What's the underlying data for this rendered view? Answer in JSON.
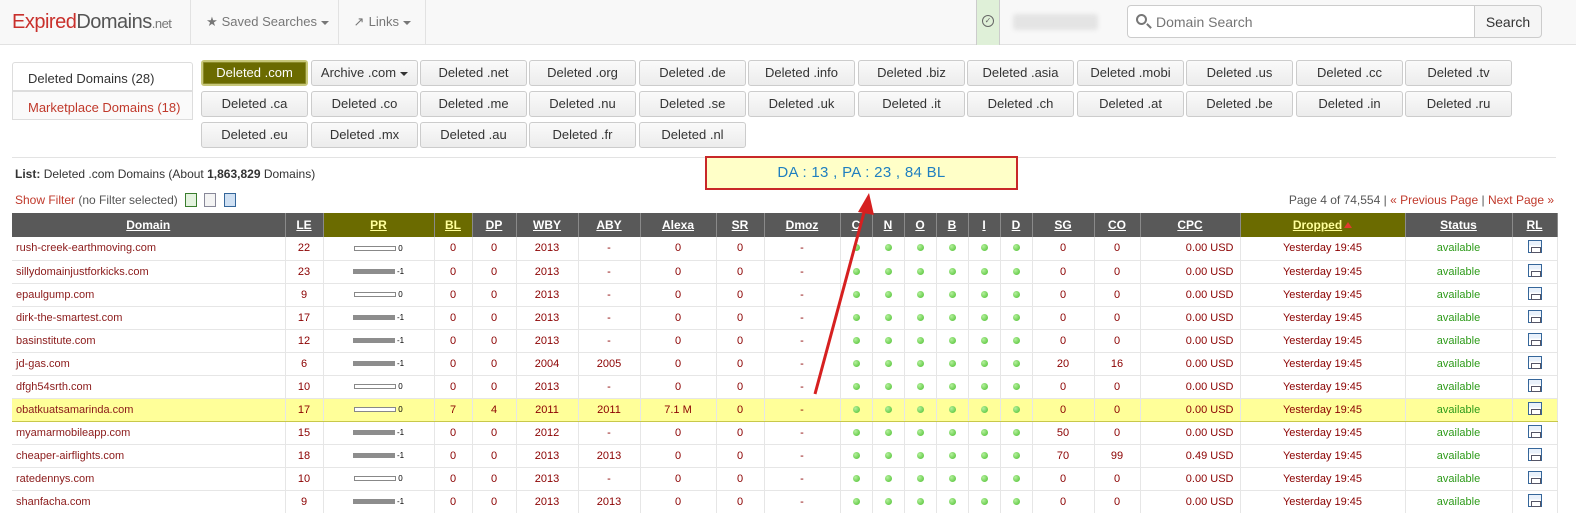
{
  "logo": {
    "part1": "Expired",
    "part2": "Domains",
    "part3": ".net"
  },
  "nav": {
    "saved_searches": "Saved Searches",
    "links": "Links"
  },
  "search": {
    "placeholder": "Domain Search",
    "button": "Search"
  },
  "left_tabs": [
    {
      "label": "Deleted Domains (28)"
    },
    {
      "label": "Marketplace Domains (18)"
    }
  ],
  "tld_buttons": [
    [
      "Deleted .com",
      "Archive .com",
      "Deleted .net",
      "Deleted .org",
      "Deleted .de",
      "Deleted .info",
      "Deleted .biz",
      "Deleted .asia",
      "Deleted .mobi",
      "Deleted .us",
      "Deleted .cc",
      "Deleted .tv"
    ],
    [
      "Deleted .ca",
      "Deleted .co",
      "Deleted .me",
      "Deleted .nu",
      "Deleted .se",
      "Deleted .uk",
      "Deleted .it",
      "Deleted .ch",
      "Deleted .at",
      "Deleted .be",
      "Deleted .in",
      "Deleted .ru"
    ],
    [
      "Deleted .eu",
      "Deleted .mx",
      "Deleted .au",
      "Deleted .fr",
      "Deleted .nl"
    ]
  ],
  "list_info": {
    "prefix": "List:",
    "name": "Deleted .com Domains (About",
    "count": "1,863,829",
    "suffix": "Domains)"
  },
  "filter": {
    "link": "Show Filter",
    "note": "(no Filter selected)"
  },
  "pagination": {
    "page": "Page 4 of 74,554",
    "sep": "|",
    "prev": "« Previous Page",
    "next": "Next Page »"
  },
  "annotation": "DA : 13 , PA : 23 , 84 BL",
  "table": {
    "columns": [
      "Domain",
      "LE",
      "PR",
      "BL",
      "DP",
      "WBY",
      "ABY",
      "Alexa",
      "SR",
      "Dmoz",
      "C",
      "N",
      "O",
      "B",
      "I",
      "D",
      "SG",
      "CO",
      "CPC",
      "Dropped",
      "Status",
      "RL"
    ],
    "rows": [
      {
        "domain": "rush-creek-earthmoving.com",
        "le": "22",
        "pr": "0",
        "bl": "0",
        "dp": "0",
        "wby": "2013",
        "aby": "-",
        "alexa": "0",
        "sr": "0",
        "dmoz": "-",
        "sg": "0",
        "co": "0",
        "cpc": "0.00 USD",
        "dropped": "Yesterday 19:45",
        "status": "available"
      },
      {
        "domain": "sillydomainjustforkicks.com",
        "le": "23",
        "pr": "-1",
        "bl": "0",
        "dp": "0",
        "wby": "2013",
        "aby": "-",
        "alexa": "0",
        "sr": "0",
        "dmoz": "-",
        "sg": "0",
        "co": "0",
        "cpc": "0.00 USD",
        "dropped": "Yesterday 19:45",
        "status": "available"
      },
      {
        "domain": "epaulgump.com",
        "le": "9",
        "pr": "0",
        "bl": "0",
        "dp": "0",
        "wby": "2013",
        "aby": "-",
        "alexa": "0",
        "sr": "0",
        "dmoz": "-",
        "sg": "0",
        "co": "0",
        "cpc": "0.00 USD",
        "dropped": "Yesterday 19:45",
        "status": "available"
      },
      {
        "domain": "dirk-the-smartest.com",
        "le": "17",
        "pr": "-1",
        "bl": "0",
        "dp": "0",
        "wby": "2013",
        "aby": "-",
        "alexa": "0",
        "sr": "0",
        "dmoz": "-",
        "sg": "0",
        "co": "0",
        "cpc": "0.00 USD",
        "dropped": "Yesterday 19:45",
        "status": "available"
      },
      {
        "domain": "basinstitute.com",
        "le": "12",
        "pr": "-1",
        "bl": "0",
        "dp": "0",
        "wby": "2013",
        "aby": "-",
        "alexa": "0",
        "sr": "0",
        "dmoz": "-",
        "sg": "0",
        "co": "0",
        "cpc": "0.00 USD",
        "dropped": "Yesterday 19:45",
        "status": "available"
      },
      {
        "domain": "jd-gas.com",
        "le": "6",
        "pr": "-1",
        "bl": "0",
        "dp": "0",
        "wby": "2004",
        "aby": "2005",
        "alexa": "0",
        "sr": "0",
        "dmoz": "-",
        "sg": "20",
        "co": "16",
        "cpc": "0.00 USD",
        "dropped": "Yesterday 19:45",
        "status": "available"
      },
      {
        "domain": "dfgh54srth.com",
        "le": "10",
        "pr": "0",
        "bl": "0",
        "dp": "0",
        "wby": "2013",
        "aby": "-",
        "alexa": "0",
        "sr": "0",
        "dmoz": "-",
        "sg": "0",
        "co": "0",
        "cpc": "0.00 USD",
        "dropped": "Yesterday 19:45",
        "status": "available"
      },
      {
        "domain": "obatkuatsamarinda.com",
        "le": "17",
        "pr": "0",
        "bl": "7",
        "dp": "4",
        "wby": "2011",
        "aby": "2011",
        "alexa": "7.1 M",
        "sr": "0",
        "dmoz": "-",
        "sg": "0",
        "co": "0",
        "cpc": "0.00 USD",
        "dropped": "Yesterday 19:45",
        "status": "available",
        "highlight": true
      },
      {
        "domain": "myamarmobileapp.com",
        "le": "15",
        "pr": "-1",
        "bl": "0",
        "dp": "0",
        "wby": "2012",
        "aby": "-",
        "alexa": "0",
        "sr": "0",
        "dmoz": "-",
        "sg": "50",
        "co": "0",
        "cpc": "0.00 USD",
        "dropped": "Yesterday 19:45",
        "status": "available"
      },
      {
        "domain": "cheaper-airflights.com",
        "le": "18",
        "pr": "-1",
        "bl": "0",
        "dp": "0",
        "wby": "2013",
        "aby": "2013",
        "alexa": "0",
        "sr": "0",
        "dmoz": "-",
        "sg": "70",
        "co": "99",
        "cpc": "0.49 USD",
        "dropped": "Yesterday 19:45",
        "status": "available"
      },
      {
        "domain": "ratedennys.com",
        "le": "10",
        "pr": "0",
        "bl": "0",
        "dp": "0",
        "wby": "2013",
        "aby": "-",
        "alexa": "0",
        "sr": "0",
        "dmoz": "-",
        "sg": "0",
        "co": "0",
        "cpc": "0.00 USD",
        "dropped": "Yesterday 19:45",
        "status": "available"
      },
      {
        "domain": "shanfacha.com",
        "le": "9",
        "pr": "-1",
        "bl": "0",
        "dp": "0",
        "wby": "2013",
        "aby": "2013",
        "alexa": "0",
        "sr": "0",
        "dmoz": "-",
        "sg": "0",
        "co": "0",
        "cpc": "0.00 USD",
        "dropped": "Yesterday 19:45",
        "status": "available"
      }
    ]
  },
  "colors": {
    "accent": "#6b6b00",
    "link": "#c0392b",
    "available": "#2e9b1a",
    "header": "#595959",
    "highlight": "#ffff99",
    "annotation_border": "#c82828"
  }
}
